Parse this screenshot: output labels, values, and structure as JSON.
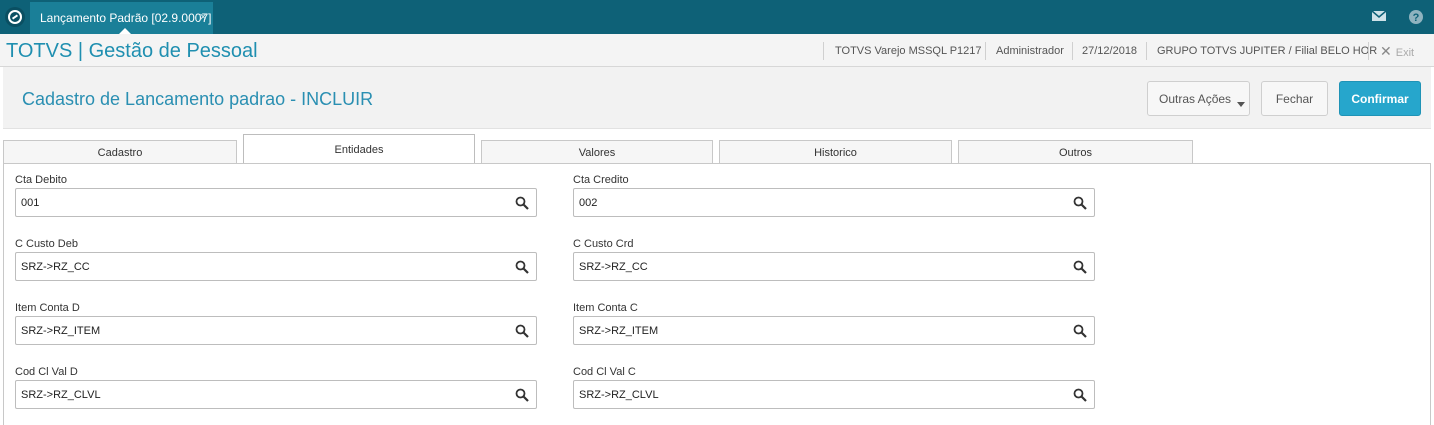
{
  "topbar": {
    "tab_label": "Lançamento Padrão [02.9.0007]",
    "tab_close": "×"
  },
  "header": {
    "brand": "TOTVS | Gestão de Pessoal",
    "environment": "TOTVS Varejo MSSQL P1217",
    "user": "Administrador",
    "date": "27/12/2018",
    "company": "GRUPO TOTVS JUPITER / Filial BELO HOR",
    "exit_icon": "✕",
    "exit_label": "Exit"
  },
  "page": {
    "title": "Cadastro de Lancamento padrao - INCLUIR"
  },
  "actions": {
    "outras": "Outras Ações",
    "fechar": "Fechar",
    "confirmar": "Confirmar"
  },
  "tabs": [
    {
      "label": "Cadastro"
    },
    {
      "label": "Entidades"
    },
    {
      "label": "Valores"
    },
    {
      "label": "Historico"
    },
    {
      "label": "Outros"
    }
  ],
  "active_tab": "Entidades",
  "fields": {
    "cta_debito": {
      "label": "Cta Debito",
      "value": "001"
    },
    "cta_credito": {
      "label": "Cta Credito",
      "value": "002"
    },
    "c_custo_deb": {
      "label": "C Custo Deb",
      "value": "SRZ->RZ_CC"
    },
    "c_custo_crd": {
      "label": "C Custo Crd",
      "value": "SRZ->RZ_CC"
    },
    "item_conta_d": {
      "label": "Item Conta D",
      "value": "SRZ->RZ_ITEM"
    },
    "item_conta_c": {
      "label": "Item Conta C",
      "value": "SRZ->RZ_ITEM"
    },
    "cod_cl_val_d": {
      "label": "Cod Cl Val D",
      "value": "SRZ->RZ_CLVL"
    },
    "cod_cl_val_c": {
      "label": "Cod Cl Val C",
      "value": "SRZ->RZ_CLVL"
    }
  },
  "colors": {
    "topbar": "#0e6177",
    "tab_active": "#1a7f98",
    "brand": "#1f8fb0",
    "confirm": "#26a6cc"
  },
  "icons": {
    "app": "totvs-logo-icon",
    "mail": "mail-icon",
    "help": "help-icon",
    "search": "search-icon"
  }
}
